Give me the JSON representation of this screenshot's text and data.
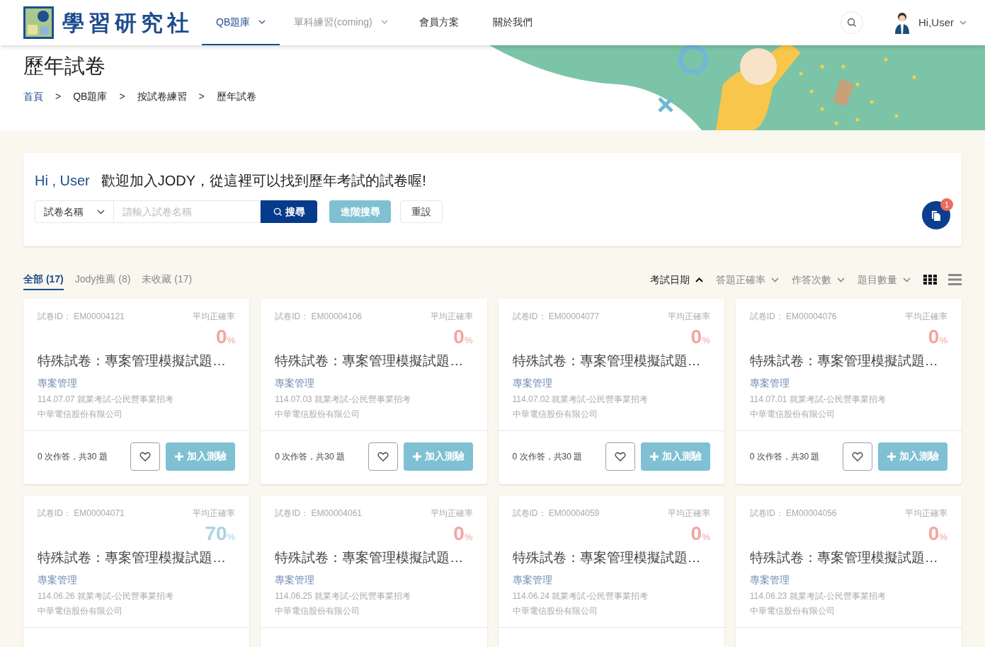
{
  "header": {
    "brand": "學習研究社",
    "nav": [
      {
        "label": "QB題庫",
        "selected": true,
        "disabled": false,
        "dropdown": true
      },
      {
        "label": "單科練習(coming)",
        "selected": false,
        "disabled": true,
        "dropdown": true
      },
      {
        "label": "會員方案",
        "selected": false,
        "disabled": false,
        "dropdown": false
      },
      {
        "label": "關於我們",
        "selected": false,
        "disabled": false,
        "dropdown": false
      }
    ],
    "user": "Hi,User"
  },
  "page_title": "歷年試卷",
  "breadcrumb": [
    "首頁",
    "QB題庫",
    "按試卷練習",
    "歷年試卷"
  ],
  "breadcrumb_separator": ">",
  "search_panel": {
    "greeting": "Hi , User",
    "welcome": "歡迎加入JODY，從這裡可以找到歷年考試的試卷喔!",
    "filter": "試卷名稱",
    "placeholder": "請輸入試卷名稱",
    "search_button": "搜尋",
    "advanced_button": "進階搜尋",
    "reset_button": "重設",
    "badge": "1"
  },
  "tabs": [
    {
      "label": "全部 (17)",
      "selected": true
    },
    {
      "label": "Jody推薦 (8)",
      "selected": false
    },
    {
      "label": "未收藏 (17)",
      "selected": false
    }
  ],
  "sorts": [
    {
      "label": "考試日期",
      "selected": true
    },
    {
      "label": "答題正確率",
      "selected": false
    },
    {
      "label": "作答次數",
      "selected": false
    },
    {
      "label": "題目數量",
      "selected": false
    }
  ],
  "view": {
    "grid_selected": true
  },
  "cards": [
    {
      "id_label": "試卷ID：",
      "id": "EM00004121",
      "rate_label": "平均正確率",
      "rate": "0",
      "rate_unit": "%",
      "color": "#f3a5a0",
      "title": "特殊試卷：專案管理模擬試題…",
      "subject": "專案管理",
      "exam": "114.07.07 就業考試-公民營事業招考",
      "org": "中華電信股份有限公司",
      "attempts": "0 次作答，共30 題",
      "add_button": "加入測驗",
      "favorite": false
    },
    {
      "id_label": "試卷ID：",
      "id": "EM00004106",
      "rate_label": "平均正確率",
      "rate": "0",
      "rate_unit": "%",
      "color": "#f3a5a0",
      "title": "特殊試卷：專案管理模擬試題…",
      "subject": "專案管理",
      "exam": "114.07.03 就業考試-公民營事業招考",
      "org": "中華電信股份有限公司",
      "attempts": "0 次作答，共30 題",
      "add_button": "加入測驗",
      "favorite": false
    },
    {
      "id_label": "試卷ID：",
      "id": "EM00004077",
      "rate_label": "平均正確率",
      "rate": "0",
      "rate_unit": "%",
      "color": "#f3a5a0",
      "title": "特殊試卷：專案管理模擬試題…",
      "subject": "專案管理",
      "exam": "114.07.02 就業考試-公民營事業招考",
      "org": "中華電信股份有限公司",
      "attempts": "0 次作答，共30 題",
      "add_button": "加入測驗",
      "favorite": false
    },
    {
      "id_label": "試卷ID：",
      "id": "EM00004076",
      "rate_label": "平均正確率",
      "rate": "0",
      "rate_unit": "%",
      "color": "#f3a5a0",
      "title": "特殊試卷：專案管理模擬試題…",
      "subject": "專案管理",
      "exam": "114.07.01 就業考試-公民營事業招考",
      "org": "中華電信股份有限公司",
      "attempts": "0 次作答，共30 題",
      "add_button": "加入測驗",
      "favorite": false
    },
    {
      "id_label": "試卷ID：",
      "id": "EM00004071",
      "rate_label": "平均正確率",
      "rate": "70",
      "rate_unit": "%",
      "color": "#a9d3e3",
      "title": "特殊試卷：專案管理模擬試題…",
      "subject": "專案管理",
      "exam": "114.06.26 就業考試-公民營事業招考",
      "org": "中華電信股份有限公司"
    },
    {
      "id_label": "試卷ID：",
      "id": "EM00004061",
      "rate_label": "平均正確率",
      "rate": "0",
      "rate_unit": "%",
      "color": "#f3a5a0",
      "title": "特殊試卷：專案管理模擬試題…",
      "subject": "專案管理",
      "exam": "114.06.25 就業考試-公民營事業招考",
      "org": "中華電信股份有限公司"
    },
    {
      "id_label": "試卷ID：",
      "id": "EM00004059",
      "rate_label": "平均正確率",
      "rate": "0",
      "rate_unit": "%",
      "color": "#f3a5a0",
      "title": "特殊試卷：專案管理模擬試題…",
      "subject": "專案管理",
      "exam": "114.06.24 就業考試-公民營事業招考",
      "org": "中華電信股份有限公司"
    },
    {
      "id_label": "試卷ID：",
      "id": "EM00004056",
      "rate_label": "平均正確率",
      "rate": "0",
      "rate_unit": "%",
      "color": "#f3a5a0",
      "title": "特殊試卷：專案管理模擬試題…",
      "subject": "專案管理",
      "exam": "114.06.23 就業考試-公民營事業招考",
      "org": "中華電信股份有限公司"
    }
  ]
}
